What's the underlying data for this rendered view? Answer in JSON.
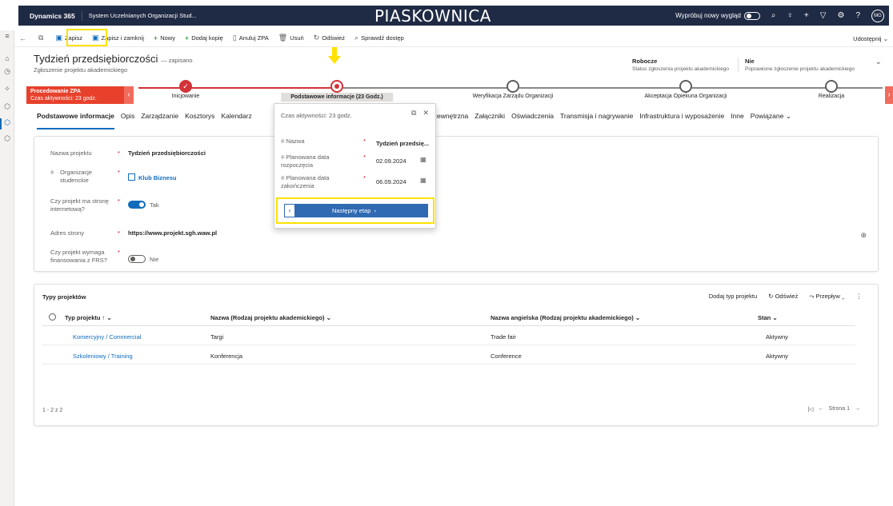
{
  "topbar": {
    "brand": "Dynamics 365",
    "environment": "System Uczelnianych Organizacji Stud...",
    "sandbox_label": "PIASKOWNICA",
    "try_new_look": "Wypróbuj nowy wygląd",
    "avatar_initials": "MG"
  },
  "commandbar": {
    "save": "Zapisz",
    "save_close": "Zapisz i zamknij",
    "new": "Nowy",
    "add_copy": "Dodaj kopię",
    "cancel_zpa": "Anuluj ZPA",
    "delete": "Usuń",
    "refresh": "Odśwież",
    "check_access": "Sprawdź dostęp",
    "share": "Udostępnij"
  },
  "header": {
    "title": "Tydzień przedsiębiorczości",
    "saved_status": "— zapisano",
    "entity": "Zgłoszenie projektu akademickiego",
    "field1_value": "Robocze",
    "field1_label": "Status zgłoszenia projektu akademickiego",
    "field2_value": "Nie",
    "field2_label": "Poprawione zgłoszenie projektu akademickiego"
  },
  "bpf": {
    "process_name": "Procedowanie ZPA",
    "process_time": "Czas aktywności: 23 godz.",
    "stages": [
      {
        "label": "Inicjowanie",
        "state": "done"
      },
      {
        "label": "Podstawowe informacje (23 Godz.)",
        "state": "current"
      },
      {
        "label": "Weryfikacja Zarządu Organizacji",
        "state": "pending"
      },
      {
        "label": "Akceptacja Opiekuna Organizacji",
        "state": "pending"
      },
      {
        "label": "Realizacja",
        "state": "pending"
      }
    ]
  },
  "tabs": [
    "Podstawowe informacje",
    "Opis",
    "Zarządzanie",
    "Kosztorys",
    "Kalendarz",
    "a zewnętrzna",
    "Załączniki",
    "Oświadczenia",
    "Transmisja i nagrywanie",
    "Infrastruktura i wyposażenie",
    "Inne",
    "Powiązane"
  ],
  "form": {
    "project_name_label": "Nazwa projektu",
    "project_name_value": "Tydzień przedsiębiorczości",
    "org_label": "Organizacje studenckie",
    "org_value": "Klub Biznesu",
    "website_q_label": "Czy projekt ma stronę internetową?",
    "website_q_value": "Tak",
    "website_label": "Adres strony",
    "website_value": "https://www.projekt.sgh.waw.pl",
    "frs_label": "Czy projekt wymaga finansowania z FRS?",
    "frs_value": "Nie"
  },
  "grid": {
    "title": "Typy projektów",
    "add_label": "Dodaj typ projektu",
    "refresh_label": "Odśwież",
    "flow_label": "Przepływ",
    "columns": [
      "Typ projektu",
      "Nazwa (Rodzaj projektu akademickiego)",
      "Nazwa angielska (Rodzaj projektu akademickiego)",
      "Stan"
    ],
    "rows": [
      {
        "type": "Komercyjny / Commercial",
        "name": "Targi",
        "name_en": "Trade fair",
        "state": "Aktywny"
      },
      {
        "type": "Szkoleniowy / Training",
        "name": "Konferencja",
        "name_en": "Conference",
        "state": "Aktywny"
      }
    ],
    "footer_count": "1 - 2 z 2",
    "page_label": "Strona 1"
  },
  "flyout": {
    "active_time": "Czas aktywności: 23 godz.",
    "name_label": "Nazwa",
    "name_value": "Tydzień przedsię...",
    "start_label": "Planowana data rozpoczęcia",
    "start_value": "02.09.2024",
    "end_label": "Planowana data zakończenia",
    "end_value": "06.09.2024",
    "next_stage": "Następny etap"
  }
}
